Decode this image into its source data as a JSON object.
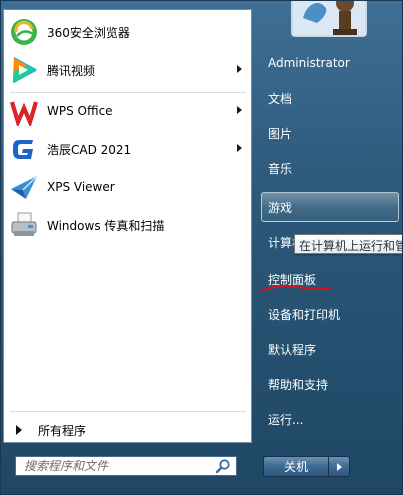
{
  "pinned": [
    {
      "label": "360安全浏览器",
      "icon": "browser-360-icon",
      "has_submenu": false
    },
    {
      "label": "腾讯视频",
      "icon": "tencent-video-icon",
      "has_submenu": true
    }
  ],
  "recent": [
    {
      "label": "WPS Office",
      "icon": "wps-office-icon",
      "has_submenu": true
    },
    {
      "label": "浩辰CAD 2021",
      "icon": "gstarcad-icon",
      "has_submenu": true
    },
    {
      "label": "XPS Viewer",
      "icon": "xps-viewer-icon",
      "has_submenu": false
    },
    {
      "label": "Windows 传真和扫描",
      "icon": "fax-scanner-icon",
      "has_submenu": false
    }
  ],
  "all_programs_label": "所有程序",
  "search": {
    "placeholder": "搜索程序和文件"
  },
  "user": {
    "name": "Administrator"
  },
  "right_items": [
    {
      "label": "文档"
    },
    {
      "label": "图片"
    },
    {
      "label": "音乐"
    },
    {
      "label": "游戏"
    },
    {
      "label": "计算机"
    },
    {
      "label": "控制面板"
    },
    {
      "label": "设备和打印机"
    },
    {
      "label": "默认程序"
    },
    {
      "label": "帮助和支持"
    },
    {
      "label": "运行..."
    }
  ],
  "tooltip": {
    "text": "在计算机上运行和管"
  },
  "shutdown": {
    "label": "关机"
  },
  "colors": {
    "panel_top": "#3f6f95",
    "panel_bottom": "#1f4765",
    "annotation_red": "#d4141e",
    "wps_red": "#d9252b",
    "gstar_blue": "#1e63c9"
  }
}
